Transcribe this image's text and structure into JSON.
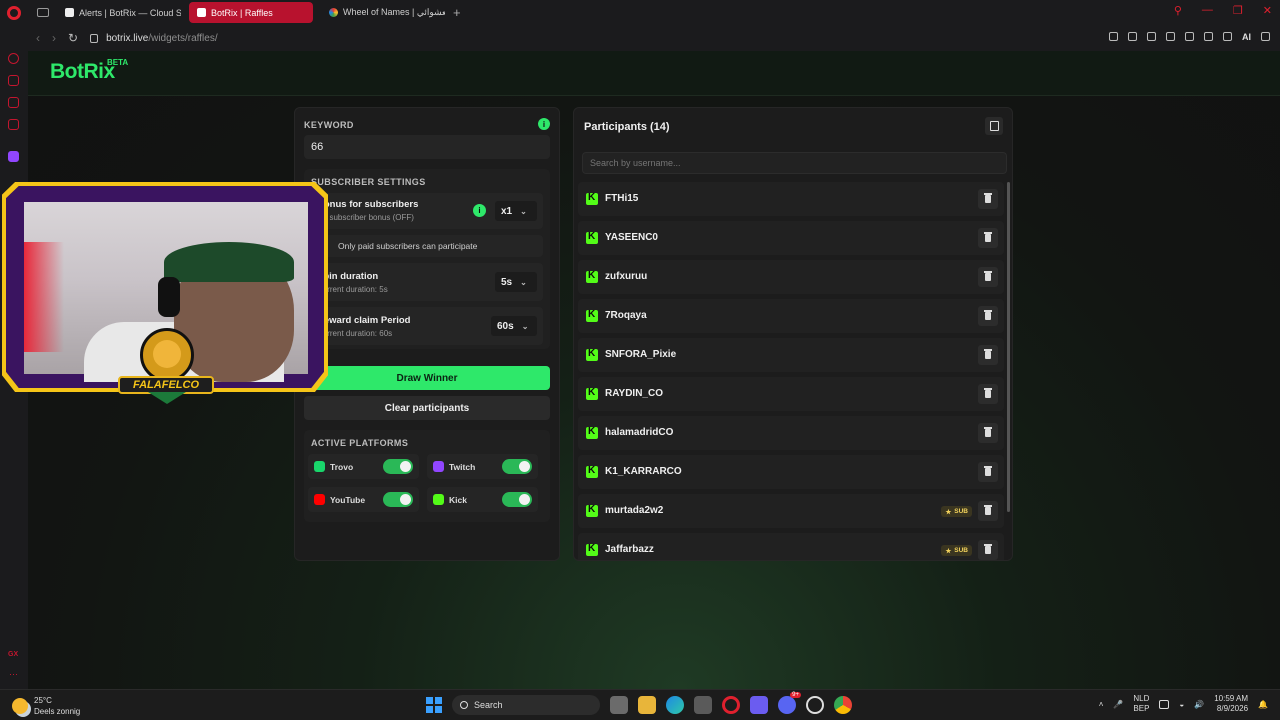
{
  "browser": {
    "tabs": [
      {
        "label": "Alerts | BotRix — Cloud Str",
        "color": "#ffffff"
      },
      {
        "label": "BotRix | Raffles",
        "color": "#ffffff",
        "active": true
      },
      {
        "label": "Wheel of Names | العشوائي",
        "color": "#4caf50"
      }
    ],
    "new_tab": "+",
    "url_host": "botrix.live",
    "url_path": "/widgets/raffles/",
    "ai_label": "AI"
  },
  "app": {
    "brand": "BotRix",
    "brand_badge": "BETA",
    "accent": "#2ee86a"
  },
  "raffle": {
    "keyword_label": "KEYWORD",
    "keyword_value": "66",
    "info_glyph": "i",
    "subscriber_settings_label": "SUBSCRIBER SETTINGS",
    "bonus_title": "Bonus for subscribers",
    "bonus_sub": "No subscriber bonus (OFF)",
    "bonus_value": "x1",
    "paid_only_label": "Only paid subscribers can participate",
    "spin_title": "Spin duration",
    "spin_sub": "Current duration: 5s",
    "spin_value": "5s",
    "reward_title": "Reward claim Period",
    "reward_sub": "Current duration: 60s",
    "reward_value": "60s",
    "draw_button": "Draw Winner",
    "clear_button": "Clear participants",
    "platforms_label": "ACTIVE PLATFORMS",
    "platforms": [
      {
        "name": "Trovo",
        "color": "#19d66b",
        "enabled": true
      },
      {
        "name": "Twitch",
        "color": "#9146ff",
        "enabled": true
      },
      {
        "name": "YouTube",
        "color": "#ff0000",
        "enabled": true
      },
      {
        "name": "Kick",
        "color": "#53fc18",
        "enabled": true
      }
    ]
  },
  "participants": {
    "title": "Participants (14)",
    "search_placeholder": "Search by username...",
    "sub_badge": "SUB",
    "items": [
      {
        "name": "FTHi15",
        "platform": "kick",
        "sub": false
      },
      {
        "name": "YASEENC0",
        "platform": "kick",
        "sub": false
      },
      {
        "name": "zufxuruu",
        "platform": "kick",
        "sub": false
      },
      {
        "name": "7Roqaya",
        "platform": "kick",
        "sub": false
      },
      {
        "name": "SNFORA_Pixie",
        "platform": "kick",
        "sub": false
      },
      {
        "name": "RAYDIN_CO",
        "platform": "kick",
        "sub": false
      },
      {
        "name": "halamadridCO",
        "platform": "kick",
        "sub": false
      },
      {
        "name": "K1_KARRARCO",
        "platform": "kick",
        "sub": false
      },
      {
        "name": "murtada2w2",
        "platform": "kick",
        "sub": true
      },
      {
        "name": "Jaffarbazz",
        "platform": "kick",
        "sub": true
      }
    ]
  },
  "overlay": {
    "badge_text": "FALAFELCO"
  },
  "taskbar": {
    "weather_temp": "25°C",
    "weather_desc": "Deels zonnig",
    "search_label": "Search",
    "lang_top": "NLD",
    "lang_bottom": "BEP",
    "time": "10:59 AM",
    "date": "8/9/2026",
    "discord_badge": "9+"
  }
}
